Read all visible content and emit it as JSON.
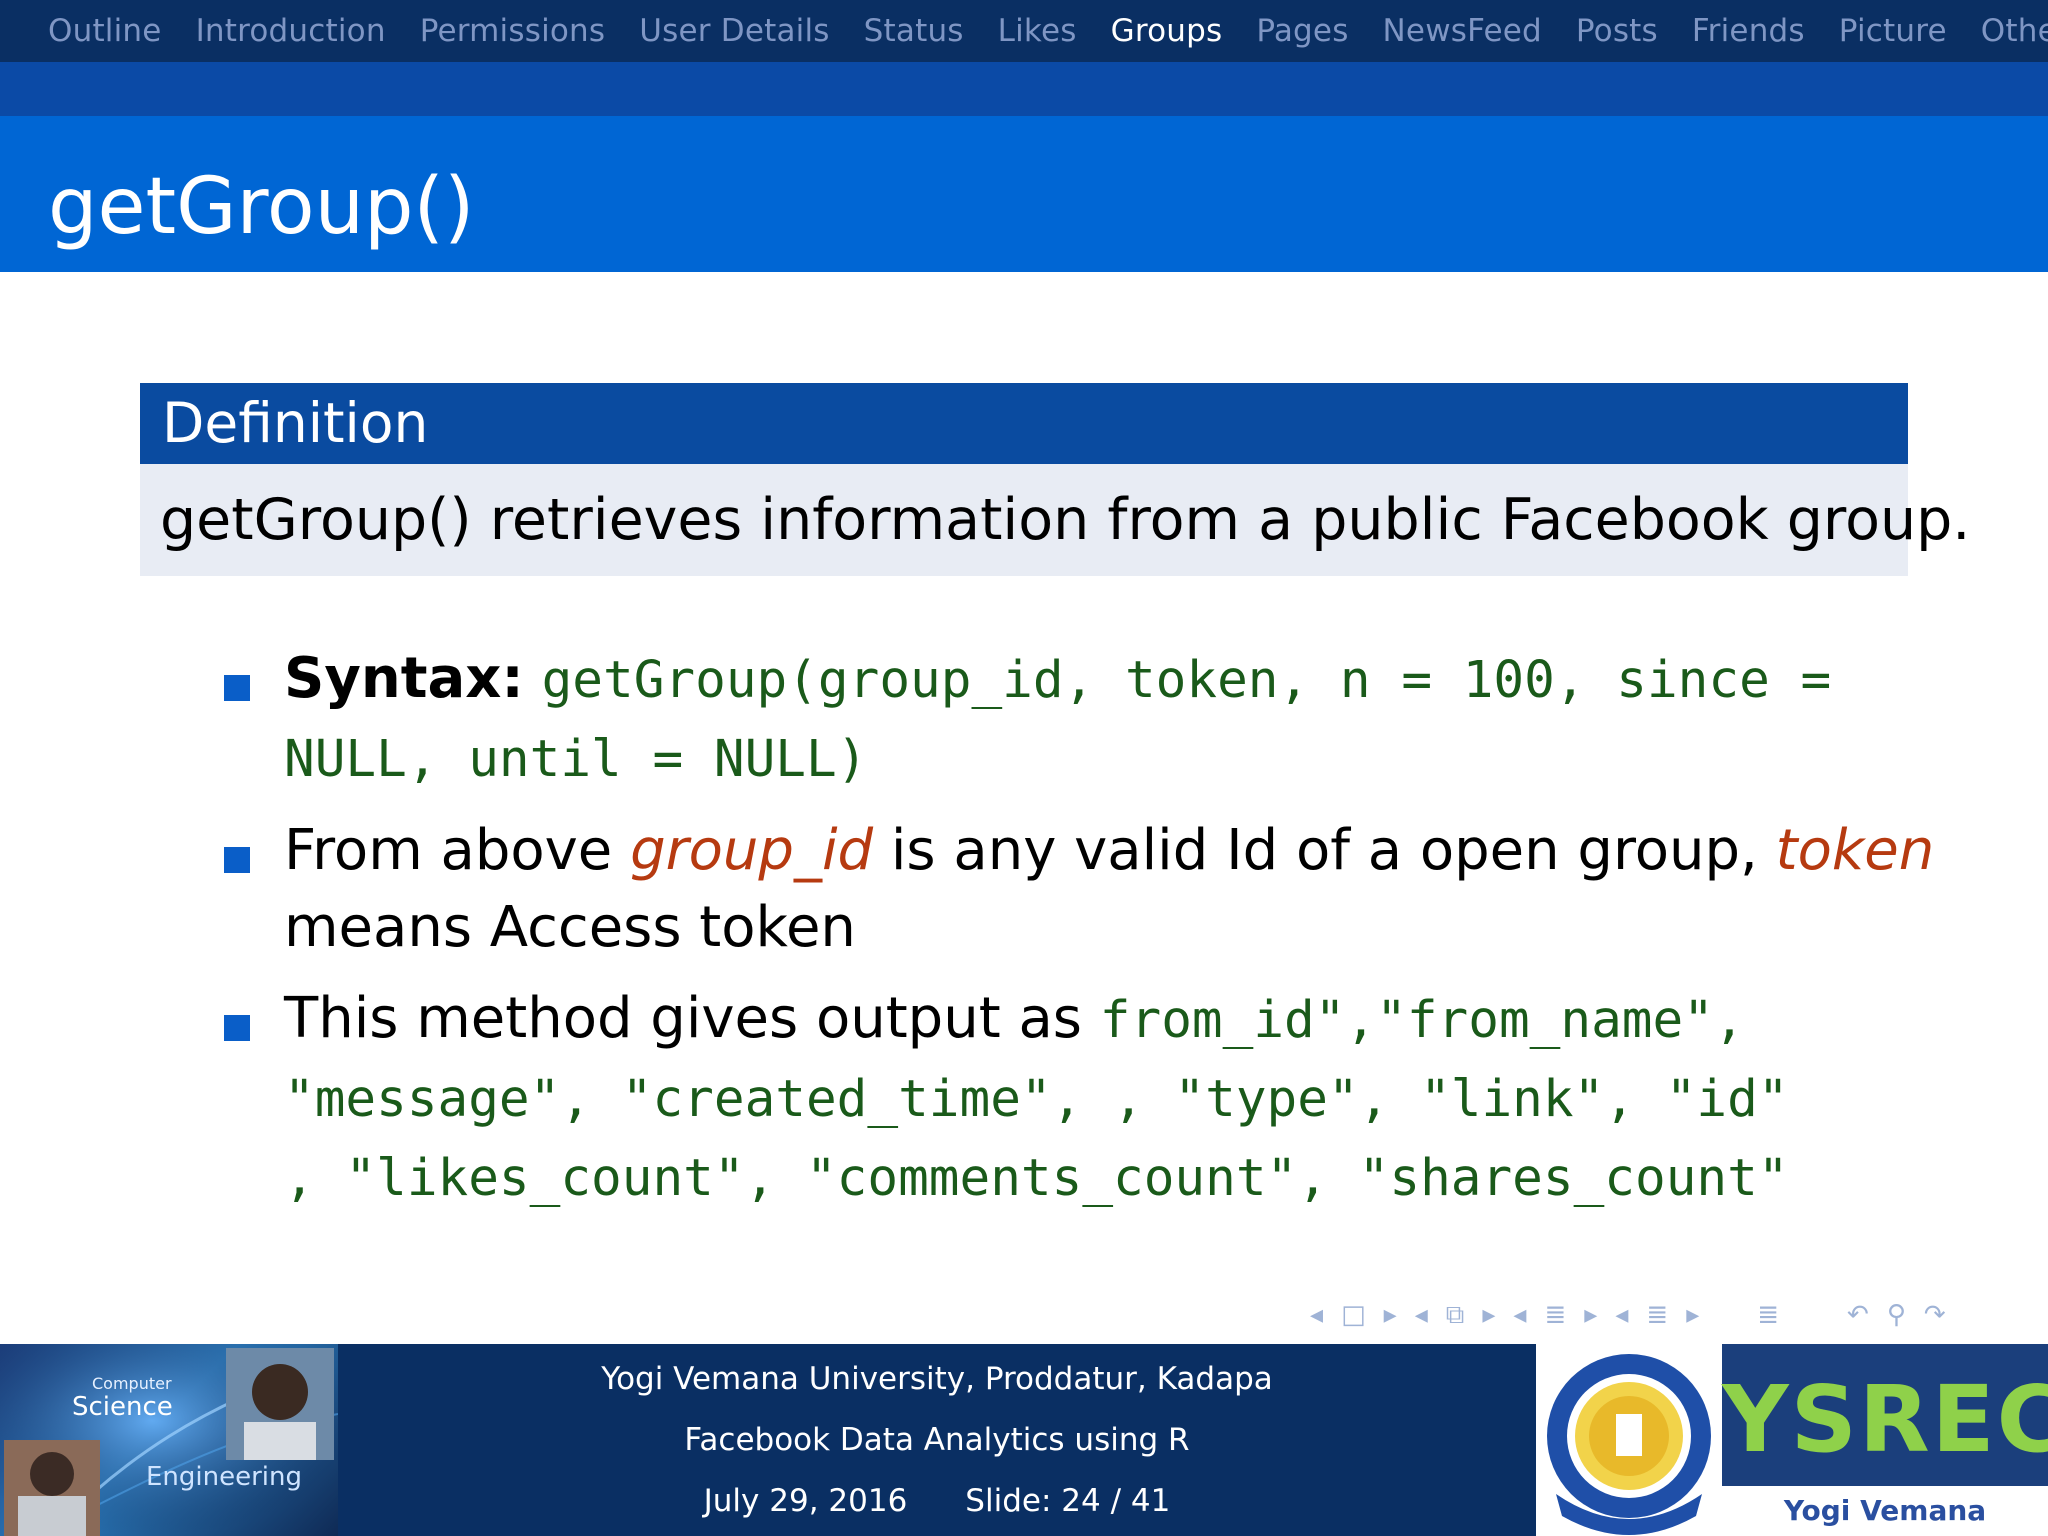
{
  "nav": {
    "items": [
      {
        "label": "Outline"
      },
      {
        "label": "Introduction"
      },
      {
        "label": "Permissions"
      },
      {
        "label": "User Details"
      },
      {
        "label": "Status"
      },
      {
        "label": "Likes"
      },
      {
        "label": "Groups",
        "active": true
      },
      {
        "label": "Pages"
      },
      {
        "label": "NewsFeed"
      },
      {
        "label": "Posts"
      },
      {
        "label": "Friends"
      },
      {
        "label": "Picture"
      },
      {
        "label": "Others"
      }
    ]
  },
  "frame": {
    "title": "getGroup()"
  },
  "definition": {
    "title": "Definition",
    "body": "getGroup() retrieves information from a public Facebook group."
  },
  "bullets": {
    "syntax_label": "Syntax:",
    "syntax_line1": "getGroup(group_id, token, n = 100, since =",
    "syntax_line2": "NULL, until = NULL)",
    "b2_prefix": "From above",
    "b2_param1": "group_id",
    "b2_mid": "is any valid Id of a open group,",
    "b2_param2": "token",
    "b2_line2": "means Access token",
    "b3_prefix": "This method gives output as",
    "b3_code1": "from_id\",\"from_name\",",
    "b3_code2": "\"message\", \"created_time\", , \"type\", \"link\", \"id\"",
    "b3_code3": ", \"likes_count\", \"comments_count\", \"shares_count\""
  },
  "footer": {
    "photo_label_1": "Computer",
    "photo_label_2": "Science",
    "photo_label_3": "Engineering",
    "university": "Yogi Vemana University, Proddatur, Kadapa",
    "talk_title": "Facebook Data Analytics using R",
    "date": "July 29, 2016",
    "slide_label": "Slide:",
    "slide_current": "24",
    "slide_total": "41",
    "slide_sep": "/",
    "brand": "YSREC",
    "brand_sub": "Yogi Vemana University"
  },
  "colors": {
    "nav_bg": "#0a2f63",
    "title_bg": "#0066d4",
    "block_head": "#0a4ba0",
    "code_green": "#1a5a1a",
    "param_red": "#b63a10"
  }
}
